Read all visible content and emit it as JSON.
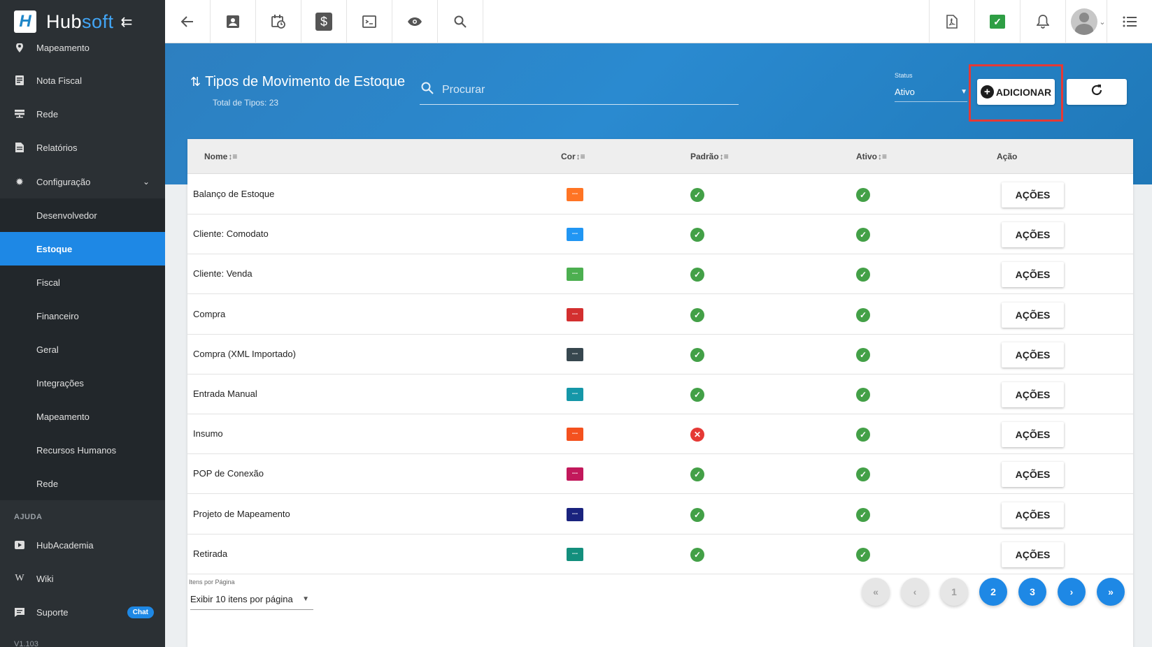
{
  "brand": {
    "mark": "H",
    "name_a": "Hub",
    "name_b": "soft",
    "collapse_icon": "collapse-arrow-icon"
  },
  "sidebar": {
    "items": [
      {
        "label": "Mapeamento",
        "icon": "map-pin-icon"
      },
      {
        "label": "Nota Fiscal",
        "icon": "receipt-icon"
      },
      {
        "label": "Rede",
        "icon": "server-icon"
      },
      {
        "label": "Relatórios",
        "icon": "document-icon"
      },
      {
        "label": "Configuração",
        "icon": "gear-icon",
        "chevron": "⌄"
      }
    ],
    "subitems": [
      {
        "label": "Desenvolvedor"
      },
      {
        "label": "Estoque",
        "active": true
      },
      {
        "label": "Fiscal"
      },
      {
        "label": "Financeiro"
      },
      {
        "label": "Geral"
      },
      {
        "label": "Integrações"
      },
      {
        "label": "Mapeamento"
      },
      {
        "label": "Recursos Humanos"
      },
      {
        "label": "Rede"
      }
    ],
    "section_help": "AJUDA",
    "help_items": [
      {
        "label": "HubAcademia",
        "icon": "video-icon"
      },
      {
        "label": "Wiki",
        "icon": "wikipedia-icon"
      },
      {
        "label": "Suporte",
        "icon": "chat-icon",
        "badge": "Chat"
      }
    ],
    "version": "V1.103"
  },
  "topbar": {
    "left_icons": [
      "back-arrow-icon",
      "contact-card-icon",
      "calendar-clock-icon",
      "dollar-icon",
      "terminal-icon",
      "eye-icon",
      "search-icon"
    ],
    "right_icons": [
      "pdf-icon",
      "check-badge-icon",
      "bell-icon",
      "avatar",
      "menu-list-icon"
    ]
  },
  "header": {
    "title": "Tipos de Movimento de Estoque",
    "subtitle": "Total de Tipos: 23",
    "search_placeholder": "Procurar",
    "status_label": "Status",
    "status_value": "Ativo",
    "add_label": "ADICIONAR"
  },
  "table": {
    "columns": [
      "Nome",
      "Cor",
      "Padrão",
      "Ativo",
      "Ação"
    ],
    "action_label": "AÇÕES",
    "rows": [
      {
        "nome": "Balanço de Estoque",
        "cor": "#ff7424",
        "padrao": true,
        "ativo": true
      },
      {
        "nome": "Cliente: Comodato",
        "cor": "#2196f3",
        "padrao": true,
        "ativo": true
      },
      {
        "nome": "Cliente: Venda",
        "cor": "#4caf50",
        "padrao": true,
        "ativo": true
      },
      {
        "nome": "Compra",
        "cor": "#d32f2f",
        "padrao": true,
        "ativo": true
      },
      {
        "nome": "Compra (XML Importado)",
        "cor": "#37474f",
        "padrao": true,
        "ativo": true
      },
      {
        "nome": "Entrada Manual",
        "cor": "#1597a8",
        "padrao": true,
        "ativo": true
      },
      {
        "nome": "Insumo",
        "cor": "#f4511e",
        "padrao": false,
        "ativo": true
      },
      {
        "nome": "POP de Conexão",
        "cor": "#c2185b",
        "padrao": true,
        "ativo": true
      },
      {
        "nome": "Projeto de Mapeamento",
        "cor": "#1a237e",
        "padrao": true,
        "ativo": true
      },
      {
        "nome": "Retirada",
        "cor": "#138f7d",
        "padrao": true,
        "ativo": true
      }
    ],
    "swatch_text": "..."
  },
  "pagination": {
    "per_page_label": "Itens por Página",
    "per_page_value": "Exibir 10 itens por página",
    "buttons": [
      {
        "label": "«",
        "enabled": false
      },
      {
        "label": "‹",
        "enabled": false
      },
      {
        "label": "1",
        "enabled": false
      },
      {
        "label": "2",
        "enabled": true
      },
      {
        "label": "3",
        "enabled": true
      },
      {
        "label": "›",
        "enabled": true
      },
      {
        "label": "»",
        "enabled": true
      }
    ]
  }
}
